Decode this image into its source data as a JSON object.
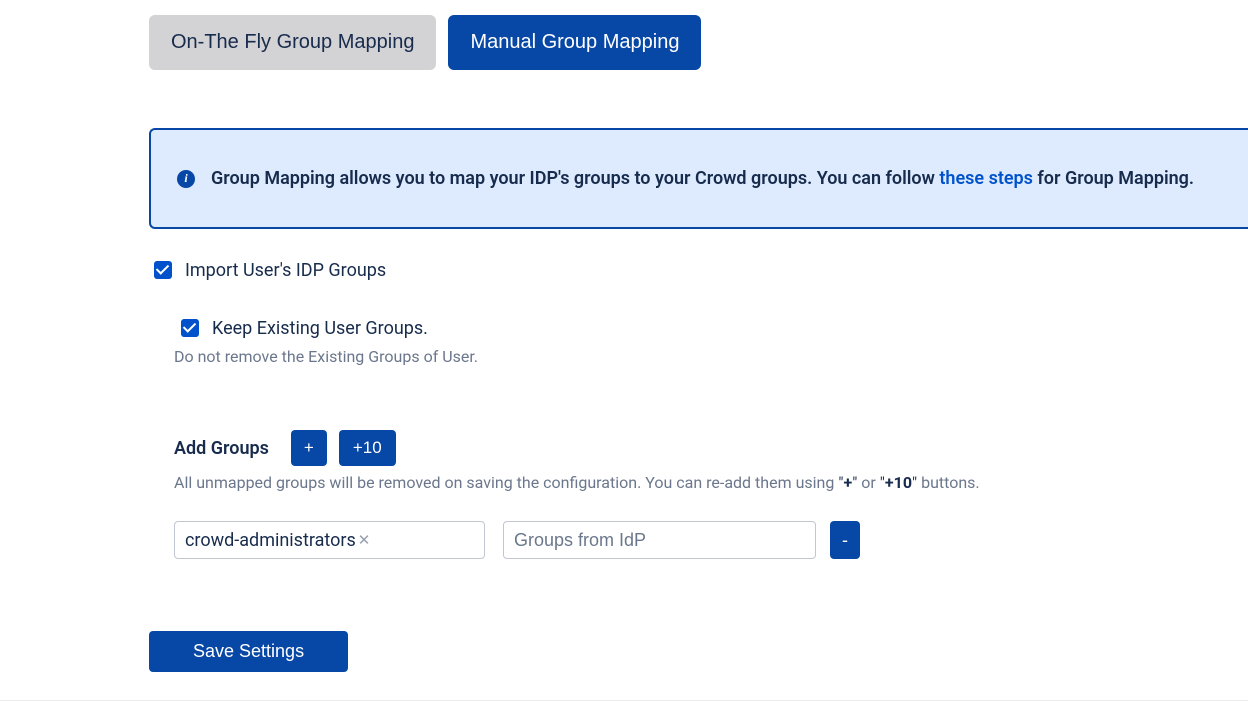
{
  "tabs": {
    "on_the_fly": "On-The Fly Group Mapping",
    "manual": "Manual Group Mapping"
  },
  "info": {
    "text_prefix": "Group Mapping allows you to map your IDP's groups to your Crowd groups. You can follow ",
    "link": "these steps",
    "text_suffix": " for Group Mapping."
  },
  "import_idp": {
    "label": "Import User's IDP Groups"
  },
  "keep_existing": {
    "label": "Keep Existing User Groups.",
    "hint": "Do not remove the Existing Groups of User."
  },
  "add_groups": {
    "label": "Add Groups",
    "plus_label": "+",
    "plus10_label": "+10",
    "hint_prefix": "All unmapped groups will be removed on saving the configuration. You can re-add them using ",
    "hint_q1": "\"",
    "hint_plus": "+",
    "hint_q2": "\"",
    "hint_or": " or ",
    "hint_q3": "\"",
    "hint_plus10": "+10",
    "hint_q4": "\"",
    "hint_suffix": " buttons."
  },
  "mapping": {
    "tag": "crowd-administrators",
    "tag_x": "✕",
    "idp_placeholder": "Groups from IdP",
    "minus_label": "-"
  },
  "save": {
    "label": "Save Settings"
  }
}
